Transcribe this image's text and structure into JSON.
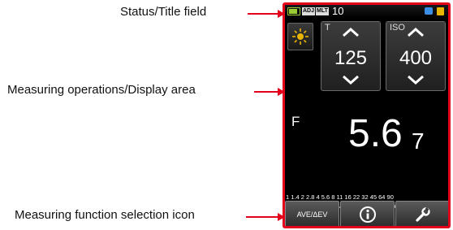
{
  "callouts": {
    "status": "Status/Title field",
    "display": "Measuring operations/Display area",
    "function": "Measuring function selection icon"
  },
  "screen": {
    "status_bar": {
      "tags": [
        "ADJ",
        "MLT"
      ],
      "value": "10"
    },
    "shutter": {
      "label": "T",
      "value": "125"
    },
    "iso": {
      "label": "ISO",
      "value": "400"
    },
    "aperture": {
      "label": "F",
      "main": "5.6",
      "tenths": "7"
    },
    "scale_labels": "1  1.4  2  2.8  4  5.6  8  11  16  22 32 45 64 90",
    "buttons": {
      "ave_label": "AVE/ΔEV"
    }
  },
  "colors": {
    "frame": "#e2001a",
    "screen": "#000000",
    "accent": "#e9b400"
  },
  "icons": [
    "sun-icon",
    "up-chevron-icon",
    "down-chevron-icon",
    "info-icon",
    "wrench-icon",
    "battery-icon"
  ]
}
